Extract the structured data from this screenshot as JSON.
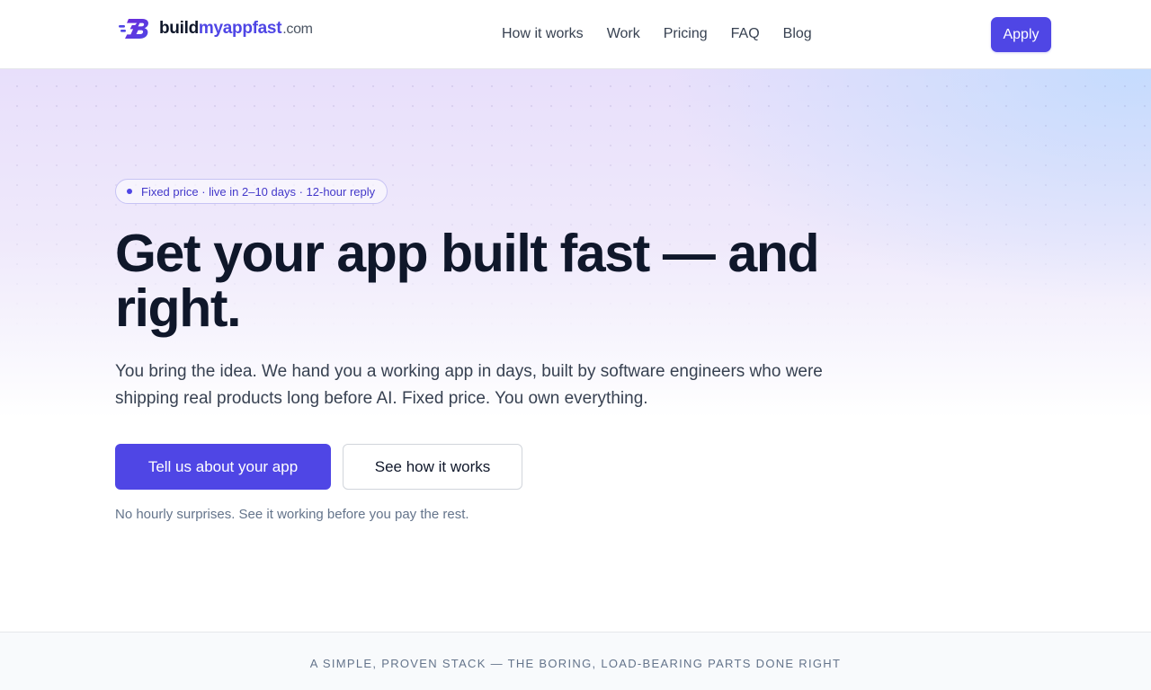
{
  "header": {
    "logo": {
      "name_main": "build",
      "name_accent": "myappfast",
      "name_tld": ".com",
      "icon": "b-lettermark-speed-icon",
      "brand_color": "#4f46e5"
    },
    "nav": [
      {
        "label": "How it works"
      },
      {
        "label": "Work"
      },
      {
        "label": "Pricing"
      },
      {
        "label": "FAQ"
      },
      {
        "label": "Blog"
      }
    ],
    "apply_label": "Apply"
  },
  "hero": {
    "badge": "Fixed price · live in 2–10 days · 12-hour reply",
    "headline": "Get your app built fast — and right.",
    "subtext": "You bring the idea. We hand you a working app in days, built by software engineers who were shipping real products long before AI. Fixed price. You own everything.",
    "primary_cta": "Tell us about your app",
    "secondary_cta": "See how it works",
    "note": "No hourly surprises. See it working before you pay the rest."
  },
  "stack": {
    "label": "A SIMPLE, PROVEN STACK — THE BORING, LOAD-BEARING PARTS DONE RIGHT"
  },
  "colors": {
    "accent": "#4f46e5",
    "text_dark": "#0f172a",
    "text_muted": "#64748b"
  }
}
